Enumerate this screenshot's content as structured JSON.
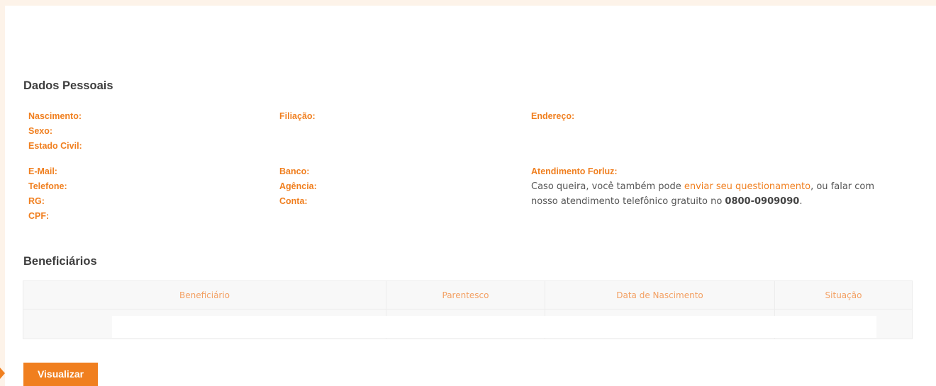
{
  "personal": {
    "title": "Dados Pessoais",
    "nascimento": "Nascimento:",
    "sexo": "Sexo:",
    "estado_civil": "Estado Civil:",
    "filiacao": "Filiação:",
    "endereco": "Endereço:",
    "email": "E-Mail:",
    "telefone": "Telefone:",
    "rg": "RG:",
    "cpf": "CPF:",
    "banco": "Banco:",
    "agencia": "Agência:",
    "conta": "Conta:"
  },
  "support": {
    "title": "Atendimento Forluz:",
    "text_before_link": "Caso queira, você também pode ",
    "link": "enviar seu questionamento",
    "text_after_link": ", ou falar com",
    "line2_prefix": "nosso atendimento telefônico gratuito no ",
    "phone": "0800-0909090",
    "line2_suffix": "."
  },
  "beneficiaries": {
    "title": "Beneficiários",
    "columns": [
      "Beneficiário",
      "Parentesco",
      "Data de Nascimento",
      "Situação"
    ]
  },
  "actions": {
    "view_label": "Visualizar"
  },
  "colors": {
    "accent": "#f07f1f",
    "page_bg": "#fdf3e9"
  }
}
